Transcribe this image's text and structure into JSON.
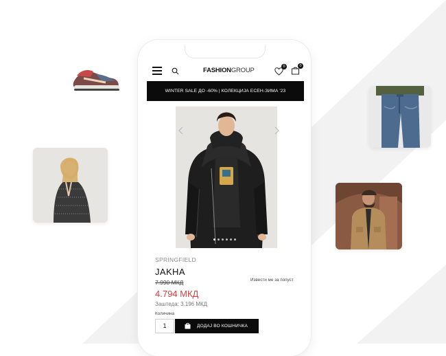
{
  "header": {
    "logo_bold": "FASHION",
    "logo_light": "GROUP",
    "wishlist_count": "0",
    "cart_count": "0"
  },
  "promo": {
    "text": "WINTER SALE ДО -60% | КОЛЕКЦИЈА ЕСЕН-ЗИМА '23"
  },
  "product": {
    "brand": "SPRINGFIELD",
    "name": "JAKHA",
    "old_price": "7.990 МКД",
    "new_price": "4.794 МКД",
    "savings": "Заштеда: 3.196 МКД",
    "notify_link": "Извести ме за попуст",
    "quantity_label": "Количина",
    "quantity_value": "1",
    "add_to_cart_label": "ДОДАЈ ВО КОШНИЧКА"
  },
  "colors": {
    "accent_black": "#0b0b0b",
    "sale_red": "#e03b3b",
    "background_gray": "#f2f2f2"
  },
  "icons": [
    "menu-icon",
    "search-icon",
    "heart-icon",
    "shopping-bag-icon",
    "chevron-left-icon",
    "chevron-right-icon"
  ]
}
